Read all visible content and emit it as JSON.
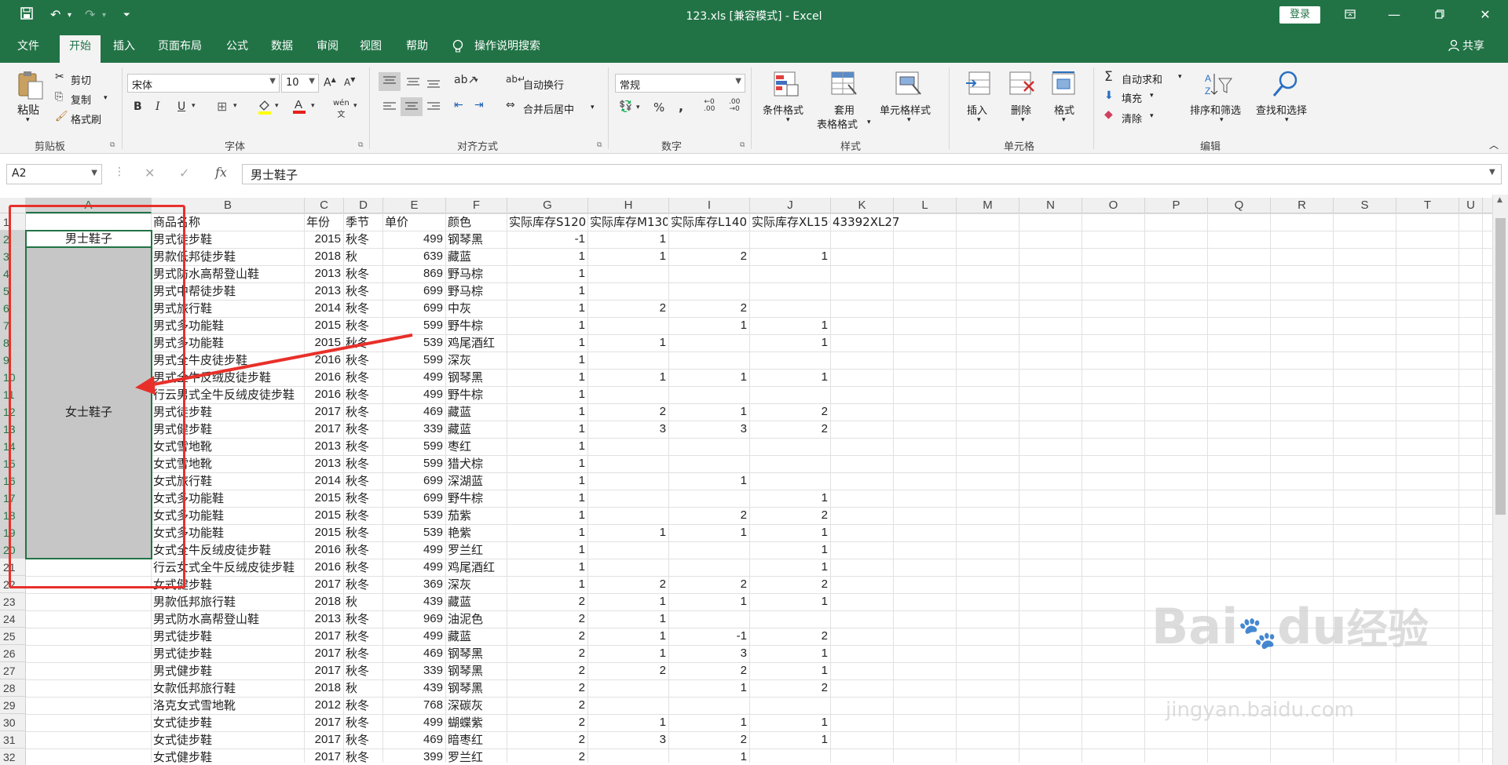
{
  "window": {
    "title": "123.xls  [兼容模式]  -  Excel",
    "login_label": "登录",
    "share_label": "共享"
  },
  "tabs": [
    "文件",
    "开始",
    "插入",
    "页面布局",
    "公式",
    "数据",
    "审阅",
    "视图",
    "帮助"
  ],
  "tell_me": "操作说明搜索",
  "ribbon": {
    "clipboard": {
      "label": "剪贴板",
      "paste": "粘贴",
      "cut": "剪切",
      "copy": "复制",
      "painter": "格式刷"
    },
    "font": {
      "label": "字体",
      "name": "宋体",
      "size": "10"
    },
    "alignment": {
      "label": "对齐方式",
      "wrap": "自动换行",
      "merge": "合并后居中"
    },
    "number": {
      "label": "数字",
      "format": "常规"
    },
    "styles": {
      "label": "样式",
      "conditional": "条件格式",
      "table_line1": "套用",
      "table_line2": "表格格式",
      "cell_styles": "单元格样式"
    },
    "cells": {
      "label": "单元格",
      "insert": "插入",
      "delete": "删除",
      "format": "格式"
    },
    "editing": {
      "label": "编辑",
      "autosum": "自动求和",
      "fill": "填充",
      "clear": "清除",
      "sort": "排序和筛选",
      "find": "查找和选择"
    }
  },
  "formula_bar": {
    "name_box": "A2",
    "content": "男士鞋子"
  },
  "columns": [
    "A",
    "B",
    "C",
    "D",
    "E",
    "F",
    "G",
    "H",
    "I",
    "J",
    "K",
    "L",
    "M",
    "N",
    "O",
    "P",
    "Q",
    "R",
    "S",
    "T",
    "U"
  ],
  "header_row": [
    "",
    "商品名称",
    "年份",
    "季节",
    "单价",
    "颜色",
    "实际库存S120",
    "实际库存M130",
    "实际库存L140",
    "实际库存XL150",
    "43392XL27"
  ],
  "merged_labels": {
    "men": "男士鞋子",
    "women": "女士鞋子"
  },
  "rows": [
    [
      "男式徒步鞋",
      2015,
      "秋冬",
      499,
      "钢琴黑",
      -1,
      1,
      "",
      ""
    ],
    [
      "男款低邦徒步鞋",
      2018,
      "秋",
      639,
      "藏蓝",
      1,
      1,
      2,
      1
    ],
    [
      "男式防水高帮登山鞋",
      2013,
      "秋冬",
      869,
      "野马棕",
      1,
      "",
      "",
      ""
    ],
    [
      "男式中帮徒步鞋",
      2013,
      "秋冬",
      699,
      "野马棕",
      1,
      "",
      "",
      ""
    ],
    [
      "男式旅行鞋",
      2014,
      "秋冬",
      699,
      "中灰",
      1,
      2,
      2,
      ""
    ],
    [
      "男式多功能鞋",
      2015,
      "秋冬",
      599,
      "野牛棕",
      1,
      "",
      1,
      1
    ],
    [
      "男式多功能鞋",
      2015,
      "秋冬",
      539,
      "鸡尾酒红",
      1,
      1,
      "",
      1
    ],
    [
      "男式全牛皮徒步鞋",
      2016,
      "秋冬",
      599,
      "深灰",
      1,
      "",
      "",
      ""
    ],
    [
      "男式全牛反绒皮徒步鞋",
      2016,
      "秋冬",
      499,
      "钢琴黑",
      1,
      1,
      1,
      1
    ],
    [
      "行云男式全牛反绒皮徒步鞋",
      2016,
      "秋冬",
      499,
      "野牛棕",
      1,
      "",
      "",
      ""
    ],
    [
      "男式徒步鞋",
      2017,
      "秋冬",
      469,
      "藏蓝",
      1,
      2,
      1,
      2
    ],
    [
      "男式健步鞋",
      2017,
      "秋冬",
      339,
      "藏蓝",
      1,
      3,
      3,
      2
    ],
    [
      "女式雪地靴",
      2013,
      "秋冬",
      599,
      "枣红",
      1,
      "",
      "",
      ""
    ],
    [
      "女式雪地靴",
      2013,
      "秋冬",
      599,
      "猎犬棕",
      1,
      "",
      "",
      ""
    ],
    [
      "女式旅行鞋",
      2014,
      "秋冬",
      699,
      "深湖蓝",
      1,
      "",
      1,
      ""
    ],
    [
      "女式多功能鞋",
      2015,
      "秋冬",
      699,
      "野牛棕",
      1,
      "",
      "",
      1
    ],
    [
      "女式多功能鞋",
      2015,
      "秋冬",
      539,
      "茄紫",
      1,
      "",
      2,
      2
    ],
    [
      "女式多功能鞋",
      2015,
      "秋冬",
      539,
      "艳紫",
      1,
      1,
      1,
      1
    ],
    [
      "女式全牛反绒皮徒步鞋",
      2016,
      "秋冬",
      499,
      "罗兰红",
      1,
      "",
      "",
      1
    ],
    [
      "行云女式全牛反绒皮徒步鞋",
      2016,
      "秋冬",
      499,
      "鸡尾酒红",
      1,
      "",
      "",
      1
    ],
    [
      "女式健步鞋",
      2017,
      "秋冬",
      369,
      "深灰",
      1,
      2,
      2,
      2
    ],
    [
      "男款低邦旅行鞋",
      2018,
      "秋",
      439,
      "藏蓝",
      2,
      1,
      1,
      1
    ],
    [
      "男式防水高帮登山鞋",
      2013,
      "秋冬",
      969,
      "油泥色",
      2,
      1,
      "",
      ""
    ],
    [
      "男式徒步鞋",
      2017,
      "秋冬",
      499,
      "藏蓝",
      2,
      1,
      -1,
      2
    ],
    [
      "男式徒步鞋",
      2017,
      "秋冬",
      469,
      "钢琴黑",
      2,
      1,
      3,
      1
    ],
    [
      "男式健步鞋",
      2017,
      "秋冬",
      339,
      "钢琴黑",
      2,
      2,
      2,
      1
    ],
    [
      "女款低邦旅行鞋",
      2018,
      "秋",
      439,
      "钢琴黑",
      2,
      "",
      1,
      2
    ],
    [
      "洛克女式雪地靴",
      2012,
      "秋冬",
      768,
      "深碳灰",
      2,
      "",
      "",
      ""
    ],
    [
      "女式徒步鞋",
      2017,
      "秋冬",
      499,
      "蝴蝶紫",
      2,
      1,
      1,
      1
    ],
    [
      "女式徒步鞋",
      2017,
      "秋冬",
      469,
      "暗枣红",
      2,
      3,
      2,
      1
    ],
    [
      "女式健步鞋",
      2017,
      "秋冬",
      399,
      "罗兰红",
      2,
      "",
      1,
      ""
    ]
  ],
  "watermark": {
    "brand": "Bai",
    "brand2": "du",
    "cn": "经验",
    "url": "jingyan.baidu.com"
  }
}
